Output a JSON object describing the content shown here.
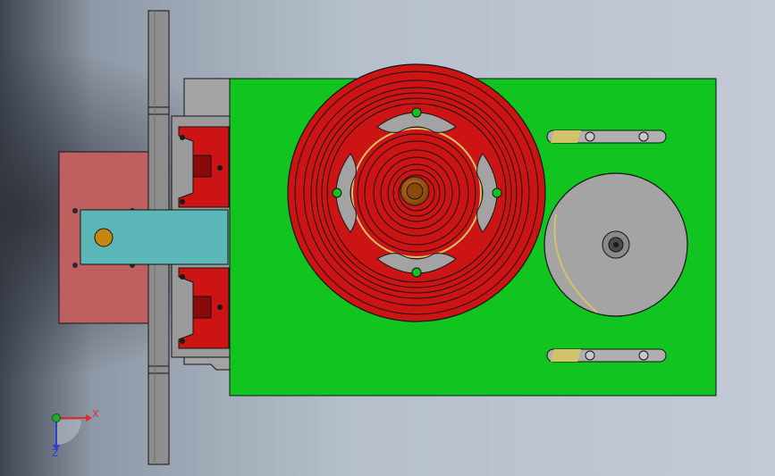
{
  "view": {
    "background_gradient": [
      "#3f4550",
      "#8f98a6",
      "#b6bfcc",
      "#c3cad6"
    ]
  },
  "colors": {
    "rail_grey": "#8e8e8e",
    "rail_grey_light": "#a3a3a3",
    "block_grey": "#9a9a9a",
    "pink_plate": "#bf5f5f",
    "green_plate": "#12c41f",
    "teal_bar": "#5cb8b8",
    "red_part": "#cc1414",
    "red_dark": "#8a0a0a",
    "grey_part": "#9a9a9a",
    "grey_disk": "#a4a4a4",
    "orange_hub": "#b25f0f",
    "bolt_gold": "#c8860f",
    "yellow_accent": "#d2c26a",
    "line": "#141414",
    "axis_x_color": "#e52b2b",
    "axis_z_color": "#2a3fd8",
    "axis_y_color": "#1faa2a"
  },
  "triad": {
    "x_label": "X",
    "z_label": "Z",
    "icon": "coordinate-triad-icon"
  }
}
